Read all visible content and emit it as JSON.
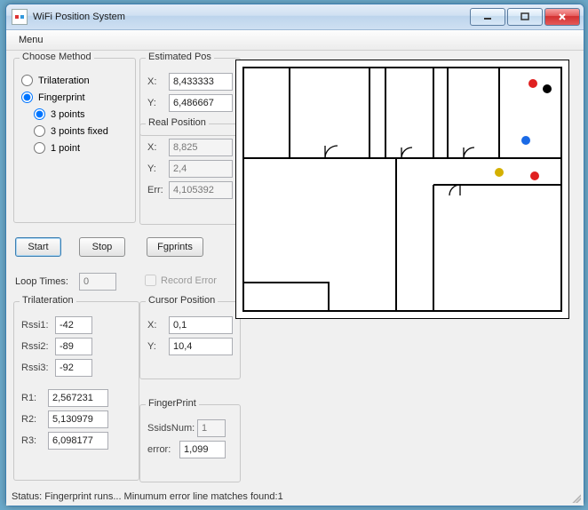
{
  "title": "WiFi Position System",
  "menu": {
    "item0": "Menu"
  },
  "method": {
    "caption": "Choose Method",
    "trilateration": "Trilateration",
    "fingerprint": "Fingerprint",
    "p3": "3 points",
    "p3f": "3 points fixed",
    "p1": "1 point"
  },
  "estpos": {
    "caption": "Estimated Pos",
    "xlabel": "X:",
    "x": "8,433333",
    "ylabel": "Y:",
    "y": "6,486667"
  },
  "realpos": {
    "caption": "Real Position",
    "xlabel": "X:",
    "x": "8,825",
    "ylabel": "Y:",
    "y": "2,4",
    "errlabel": "Err:",
    "err": "4,105392"
  },
  "buttons": {
    "start": "Start",
    "stop": "Stop",
    "fgprints": "Fgprints"
  },
  "loop": {
    "label": "Loop Times:",
    "value": "0"
  },
  "recorderror": "Record Error",
  "trilat": {
    "caption": "Trilateration",
    "rssi1l": "Rssi1:",
    "rssi1": "-42",
    "rssi2l": "Rssi2:",
    "rssi2": "-89",
    "rssi3l": "Rssi3:",
    "rssi3": "-92",
    "r1l": "R1:",
    "r1": "2,567231",
    "r2l": "R2:",
    "r2": "5,130979",
    "r3l": "R3:",
    "r3": "6,098177"
  },
  "cursor": {
    "caption": "Cursor Position",
    "xlabel": "X:",
    "x": "0,1",
    "ylabel": "Y:",
    "y": "10,4"
  },
  "fprint": {
    "caption": "FingerPrint",
    "ssidslabel": "SsidsNum:",
    "ssids": "1",
    "errorlabel": "error:",
    "error": "1,099"
  },
  "status": "Status: Fingerprint runs... Minumum error line matches found:1"
}
